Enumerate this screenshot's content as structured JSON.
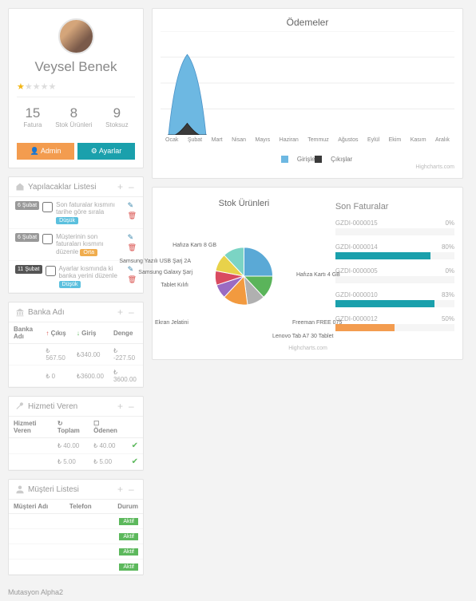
{
  "profile": {
    "name": "Veysel Benek",
    "role": "",
    "stats": [
      {
        "n": "15",
        "l": "Fatura"
      },
      {
        "n": "8",
        "l": "Stok Ürünleri"
      },
      {
        "n": "9",
        "l": "Stoksuz"
      }
    ],
    "btn_admin": "Admin",
    "btn_settings": "Ayarlar"
  },
  "todos": {
    "title": "Yapılacaklar Listesi",
    "items": [
      {
        "date": "6 Şubat",
        "dcls": "",
        "text": "Son faturalar kısmını tarihe göre sırala",
        "tag": "Düşük",
        "tcls": "tag-low"
      },
      {
        "date": "6 Şubat",
        "dcls": "",
        "text": "Müşterinin son faturaları kısmını düzenle",
        "tag": "Orta",
        "tcls": "tag-mid"
      },
      {
        "date": "11 Şubat",
        "dcls": "dark",
        "text": "Ayarlar kısmında ki banka yerini düzenle",
        "tag": "Düşük",
        "tcls": "tag-low"
      }
    ]
  },
  "banks": {
    "title": "Banka Adı",
    "headers": {
      "name": "Banka Adı",
      "out": "Çıkış",
      "in": "Giriş",
      "bal": "Denge"
    },
    "rows": [
      {
        "name": "",
        "out": "₺ 567.50",
        "in": "₺340.00",
        "bal": "₺ -227.50"
      },
      {
        "name": "",
        "out": "₺ 0",
        "in": "₺3600.00",
        "bal": "₺ 3600.00"
      }
    ]
  },
  "services": {
    "title": "Hizmeti Veren",
    "headers": {
      "name": "Hizmeti Veren",
      "total": "Toplam",
      "paid": "Ödenen"
    },
    "rows": [
      {
        "name": "",
        "total": "₺ 40.00",
        "paid": "₺ 40.00",
        "ok": true
      },
      {
        "name": "",
        "total": "₺ 5.00",
        "paid": "₺ 5.00",
        "ok": true
      }
    ]
  },
  "customers": {
    "title": "Müşteri Listesi",
    "headers": {
      "name": "Müşteri Adı",
      "phone": "Telefon",
      "status": "Durum"
    },
    "rows": [
      {
        "name": "",
        "phone": "",
        "status": "Aktif"
      },
      {
        "name": "",
        "phone": "",
        "status": "Aktif"
      },
      {
        "name": "",
        "phone": "",
        "status": "Aktif"
      },
      {
        "name": "",
        "phone": "",
        "status": "Aktif"
      }
    ]
  },
  "payments": {
    "title": "Ödemeler",
    "legend_in": "Girişler",
    "legend_out": "Çıkışlar",
    "credit": "Highcharts.com"
  },
  "chart_data": {
    "type": "area",
    "title": "Ödemeler",
    "xlabel": "",
    "ylabel": "",
    "ylim": [
      0,
      8000
    ],
    "yticks": [
      2000,
      4000,
      6000,
      8000
    ],
    "categories": [
      "Ocak",
      "Şubat",
      "Mart",
      "Nisan",
      "Mayıs",
      "Haziran",
      "Temmuz",
      "Ağustos",
      "Eylül",
      "Ekim",
      "Kasım",
      "Aralık"
    ],
    "series": [
      {
        "name": "Girişler",
        "color": "#6db8e2",
        "values": [
          0,
          6200,
          0,
          0,
          0,
          0,
          0,
          0,
          0,
          0,
          0,
          0
        ]
      },
      {
        "name": "Çıkışlar",
        "color": "#3a3a3a",
        "values": [
          0,
          900,
          0,
          0,
          0,
          0,
          0,
          0,
          0,
          0,
          0,
          0
        ]
      }
    ]
  },
  "stock": {
    "title": "Stok Ürünleri",
    "credit": "Highcharts.com"
  },
  "stock_chart": {
    "type": "pie",
    "title": "Stok Ürünleri",
    "slices": [
      {
        "label": "Hafıza Kartı 4 GB",
        "value": 25,
        "color": "#5aa9d6"
      },
      {
        "label": "Freeman FREE 075",
        "value": 13,
        "color": "#5ab45a"
      },
      {
        "label": "Lenovo Tab A7 30 Tablet",
        "value": 10,
        "color": "#b0b0b0"
      },
      {
        "label": "Ekran Jelatini",
        "value": 14,
        "color": "#f29a3f"
      },
      {
        "label": "Tablet Kılıfı",
        "value": 8,
        "color": "#9a6bc2"
      },
      {
        "label": "Samsung Galaxy Şarj",
        "value": 8,
        "color": "#d94b60"
      },
      {
        "label": "Samsung Yazılı USB Şarj 2A",
        "value": 10,
        "color": "#e8d24a"
      },
      {
        "label": "Hafıza Kartı 8 GB",
        "value": 12,
        "color": "#7bd4c4"
      }
    ]
  },
  "invoices": {
    "title": "Son Faturalar",
    "items": [
      {
        "code": "GZDI-0000015",
        "pct": 0,
        "cls": ""
      },
      {
        "code": "GZDI-0000014",
        "pct": 80,
        "cls": ""
      },
      {
        "code": "GZDI-0000005",
        "pct": 0,
        "cls": ""
      },
      {
        "code": "GZDI-0000010",
        "pct": 83,
        "cls": ""
      },
      {
        "code": "GZDI-0000012",
        "pct": 50,
        "cls": "orange"
      }
    ]
  },
  "footer": "Mutasyon Alpha2"
}
